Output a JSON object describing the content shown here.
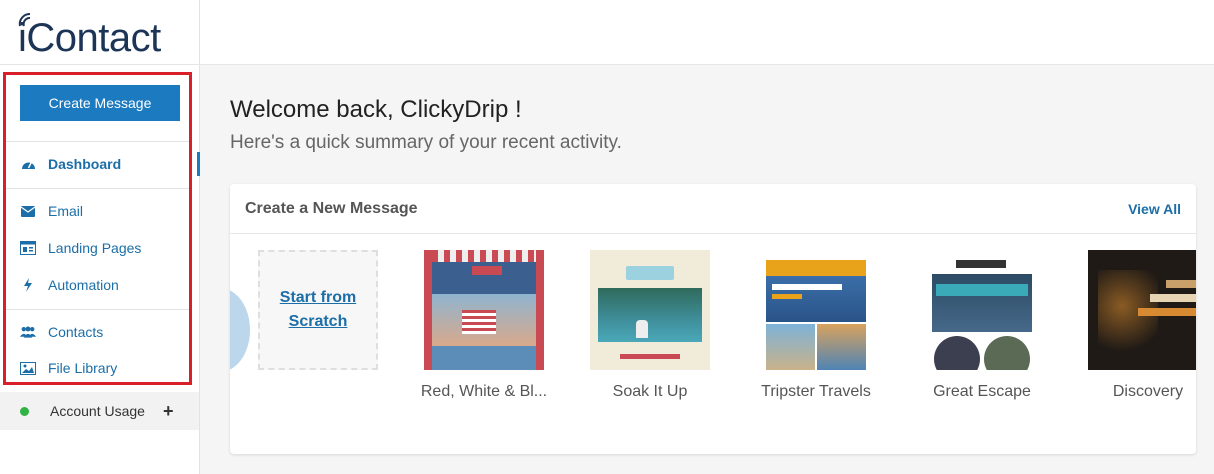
{
  "brand": {
    "logo_text": "iContact"
  },
  "sidebar": {
    "create_button": "Create Message",
    "items": [
      {
        "label": "Dashboard",
        "icon": "dashboard-icon"
      },
      {
        "label": "Email",
        "icon": "envelope-icon"
      },
      {
        "label": "Landing Pages",
        "icon": "landing-page-icon"
      },
      {
        "label": "Automation",
        "icon": "bolt-icon"
      },
      {
        "label": "Contacts",
        "icon": "users-icon"
      },
      {
        "label": "File Library",
        "icon": "image-icon"
      }
    ],
    "usage_label": "Account Usage",
    "usage_status_color": "#2fb344",
    "highlight_color": "#d9202a"
  },
  "main": {
    "welcome": "Welcome back, ClickyDrip !",
    "subtitle": "Here's a quick summary of your recent activity.",
    "card": {
      "title": "Create a New Message",
      "view_all": "View All",
      "scratch_label": "Start from Scratch",
      "templates": [
        {
          "name": "Red, White & Bl..."
        },
        {
          "name": "Soak It Up"
        },
        {
          "name": "Tripster Travels"
        },
        {
          "name": "Great Escape"
        },
        {
          "name": "Discovery"
        }
      ]
    }
  },
  "colors": {
    "accent": "#1b7ac0",
    "link": "#1b6ea8"
  }
}
